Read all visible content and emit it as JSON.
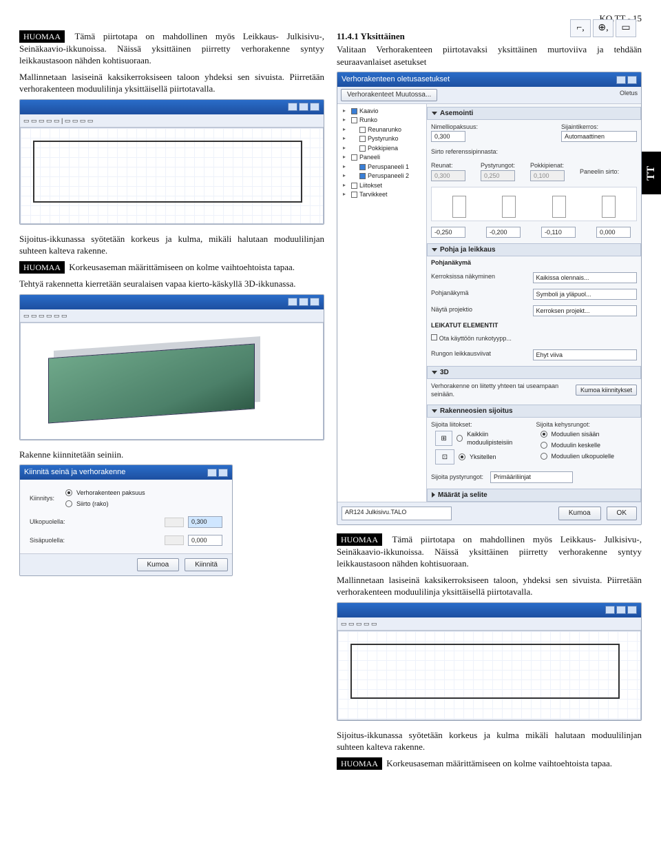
{
  "page_header": "KO.TT - 15",
  "side_tab": "TT",
  "badges": {
    "huomaa": "HUOMAA"
  },
  "col_left": {
    "p1a": " Tämä piirtotapa on mahdollinen myös Leikkaus- Julkisivu-, Seinäkaavio-ikkunoissa. Näissä yksittäinen piirretty verhorakenne syntyy leikkaustasoon nähden kohtisuoraan.",
    "p1b": "Mallinnetaan lasiseinä kaksikerroksiseen taloon yhdeksi sen sivuista. Piirretään verhorakenteen moduulilinja yksittäisellä piirtotavalla.",
    "p2a": "Sijoitus-ikkunassa syötetään korkeus ja kulma, mikäli halutaan moduulilinjan suhteen kalteva rakenne.",
    "p2b": " Korkeusaseman määrittämiseen on kolme vaihtoehtoista tapaa.",
    "p2c": "Tehtyä rakennetta kierretään seuralaisen vapaa kierto-käskyllä 3D-ikkunassa.",
    "p3": "Rakenne kiinnitetään seiniin."
  },
  "col_right": {
    "heading": "11.4.1 Yksittäinen",
    "p1": "Valitaan Verhorakenteen piirtotavaksi yksittäinen murtoviiva ja tehdään seuraavanlaiset asetukset",
    "p2a": " Tämä piirtotapa on mahdollinen myös Leikkaus- Julkisivu-, Seinäkaavio-ikkunoissa. Näissä yksittäinen piirretty verhorakenne syntyy leikkaustasoon nähden kohtisuoraan.",
    "p2b": "Mallinnetaan lasiseinä kaksikerroksiseen taloon, yhdeksi sen sivuista. Piirretään verhorakenteen moduulilinja yksittäisellä piirtotavalla.",
    "p3a": "Sijoitus-ikkunassa syötetään korkeus ja kulma mikäli halutaan moduulilinjan suhteen kalteva rakenne.",
    "p3b": " Korkeusaseman määrittämiseen on kolme vaihtoehtoista tapaa."
  },
  "dialog_settings": {
    "title": "Verhorakenteen oletusasetukset",
    "subtitle": "Verhorakenteet Muutossa...",
    "right_note": "Oletus",
    "tree": {
      "kaavio": "Kaavio",
      "runko": "Runko",
      "reunarunko": "Reunarunko",
      "pystyrunko": "Pystyrunko",
      "pokkipiena": "Pokkipiena",
      "paneeli": "Paneeli",
      "peruspaneeli1": "Peruspaneeli 1",
      "peruspaneeli2": "Peruspaneeli 2",
      "liitokset": "Liitokset",
      "tarvikkeet": "Tarvikkeet"
    },
    "asemointi": "Asemointi",
    "nimelliopaksuus": "Nimelliopaksuus:",
    "np_val": "0,300",
    "sijaintikerros": "Sijaintikerros:",
    "sk_val": "Automaattinen",
    "sirto_ref": "Sirto referenssipinnasta:",
    "reunat": "Reunat:",
    "pystyrungot": "Pystyrungot:",
    "pokkipienat": "Pokkipienat:",
    "paneelin_sirto": "Paneelin sirto:",
    "v_reunat": "0,300",
    "v_pysty": "0,250",
    "v_pokki": "0,100",
    "b1": "-0,250",
    "b2": "-0,200",
    "b3": "-0,110",
    "b4": "0,000",
    "pohja_ja_leikkaus": "Pohja ja leikkaus",
    "pohjanakymi": "Pohjanäkymä",
    "kerroksissa": "Kerroksissa näkyminen",
    "kaikissa": "Kaikissa olennais...",
    "symboli": "Symboli ja yläpuol...",
    "nayta": "Näytä projektio",
    "kerroksen": "Kerroksen projekt...",
    "leikatut": "LEIKATUT ELEMENTIT",
    "ota": "Ota käyttöön runkotyypp...",
    "rungon": "Rungon leikkausviivat",
    "ehyt": "Ehyt viiva",
    "d3": "3D",
    "vr_linked": "Verhorakenne on liitetty yhteen tai useampaan seinään.",
    "kumoa_k": "Kumoa kiinnitykset",
    "rakenneosien": "Rakenneosien sijoitus",
    "sij_lit": "Sijoita liitokset:",
    "sij_keh": "Sijoita kehysrungot:",
    "r_kaik": "Kaikkiin moduulipisteisiin",
    "r_mod_sis": "Moduulien sisään",
    "r_yks": "Yksitellen",
    "r_mod_kes": "Moduulin keskelle",
    "r_mod_ulk": "Moduulien ulkopuolelle",
    "sij_pysty": "Sijoita pystyrungot:",
    "sp_val": "Primääriliinjat",
    "maarat": "Määrät ja selite",
    "layer": "AR124 Julkisivu.TALO",
    "kumoa": "Kumoa",
    "ok": "OK"
  },
  "dialog_fix": {
    "title": "Kiinnitä seinä ja verhorakenne",
    "kiinnitys": "Kiinnitys:",
    "opt1": "Verhorakenteen paksuus",
    "opt2": "Siirto (rako)",
    "ulko": "Ulkopuolella:",
    "sisa": "Sisäpuolella:",
    "ulko_val": "0,300",
    "sisa_val": "0,000",
    "kumoa": "Kumoa",
    "kiinnita": "Kiinnitä"
  }
}
